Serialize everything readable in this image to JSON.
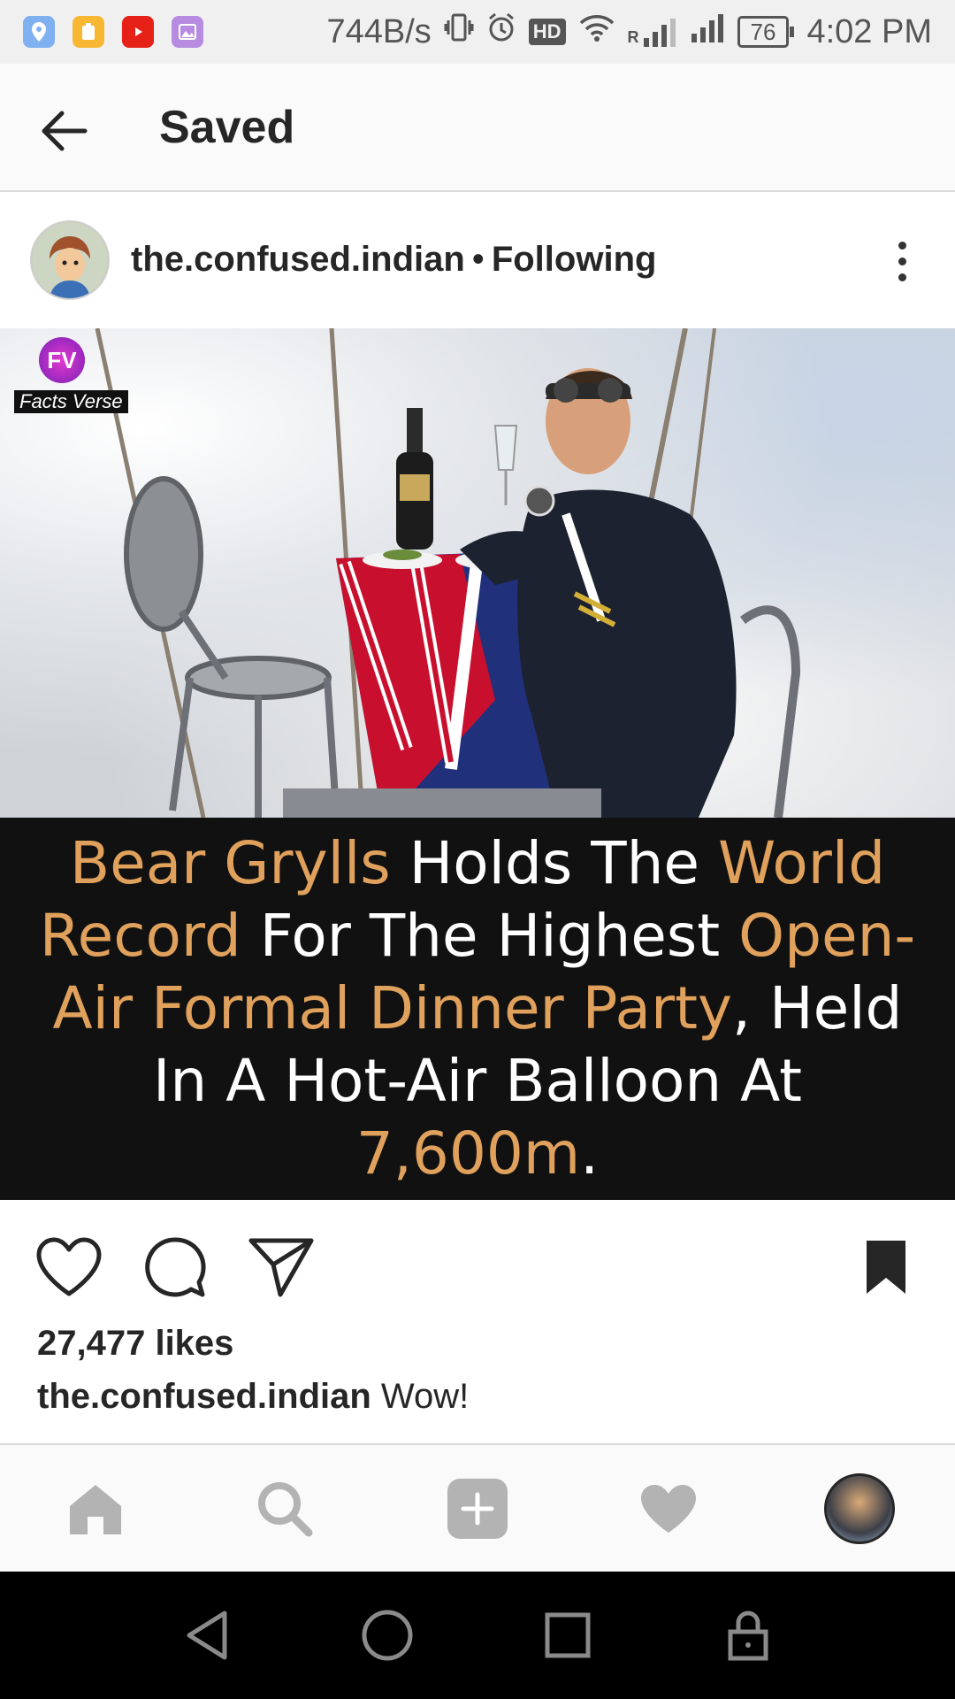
{
  "status_bar": {
    "net_speed": "744B/s",
    "hd": "HD",
    "signal_label": "R",
    "battery": "76",
    "time": "4:02 PM",
    "apps": [
      "maps-icon",
      "files-icon",
      "youtube-icon",
      "gallery-icon"
    ]
  },
  "header": {
    "title": "Saved"
  },
  "post": {
    "username": "the.confused.indian",
    "separator": "•",
    "follow_status": "Following",
    "watermark": {
      "badge": "FV",
      "label": "Facts Verse"
    },
    "image_caption": {
      "p1": "Bear Grylls",
      "p2": " Holds The ",
      "p3": "World Record",
      "p4": " For The Highest ",
      "p5": "Open-Air Formal Dinner Party",
      "p6": ", Held In A Hot-Air Balloon At ",
      "p7": "7,600m",
      "p8": "."
    },
    "likes": "27,477 likes",
    "caption_user": "the.confused.indian",
    "caption_text": "Wow!"
  },
  "colors": {
    "highlight": "#e0a15c",
    "text_primary": "#262626",
    "nav_icon": "#b3b3b3"
  }
}
